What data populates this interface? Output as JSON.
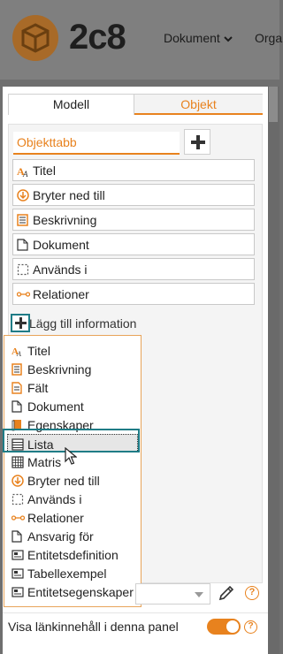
{
  "app": {
    "brand": "2c8",
    "nav": [
      {
        "label": "Dokument"
      },
      {
        "label": "Orga"
      }
    ]
  },
  "panel": {
    "tabs": [
      {
        "label": "Modell",
        "active": false
      },
      {
        "label": "Objekt",
        "active": true
      }
    ],
    "object_tab": {
      "label": "Objekttabb"
    },
    "sections": [
      {
        "label": "Titel",
        "icon": "title-icon"
      },
      {
        "label": "Bryter ned till",
        "icon": "arrow-down-circle-icon"
      },
      {
        "label": "Beskrivning",
        "icon": "description-icon"
      },
      {
        "label": "Dokument",
        "icon": "document-icon"
      },
      {
        "label": "Används i",
        "icon": "used-in-icon"
      },
      {
        "label": "Relationer",
        "icon": "relations-icon"
      }
    ],
    "add_information": {
      "label": "Lägg till information"
    },
    "menu": {
      "items": [
        {
          "label": "Titel",
          "icon": "title-icon"
        },
        {
          "label": "Beskrivning",
          "icon": "description-icon"
        },
        {
          "label": "Fält",
          "icon": "field-icon"
        },
        {
          "label": "Dokument",
          "icon": "document-icon"
        },
        {
          "label": "Egenskaper",
          "icon": "properties-icon"
        },
        {
          "label": "Lista",
          "icon": "list-icon",
          "highlighted": true
        },
        {
          "label": "Matris",
          "icon": "matrix-icon"
        },
        {
          "label": "Bryter ned till",
          "icon": "arrow-down-circle-icon"
        },
        {
          "label": "Används i",
          "icon": "used-in-icon"
        },
        {
          "label": "Relationer",
          "icon": "relations-icon"
        },
        {
          "label": "Ansvarig för",
          "icon": "document-icon"
        },
        {
          "label": "Entitetsdefinition",
          "icon": "entity-icon"
        },
        {
          "label": "Tabellexempel",
          "icon": "entity-icon"
        },
        {
          "label": "Entitetsegenskaper",
          "icon": "entity-icon"
        }
      ]
    },
    "footer": {
      "link_content_label": "Visa länkinnehåll i denna panel",
      "link_content_enabled": true,
      "help_symbol": "?"
    }
  },
  "colors": {
    "accent": "#e8821e",
    "highlight_ring": "#1f7c86"
  }
}
